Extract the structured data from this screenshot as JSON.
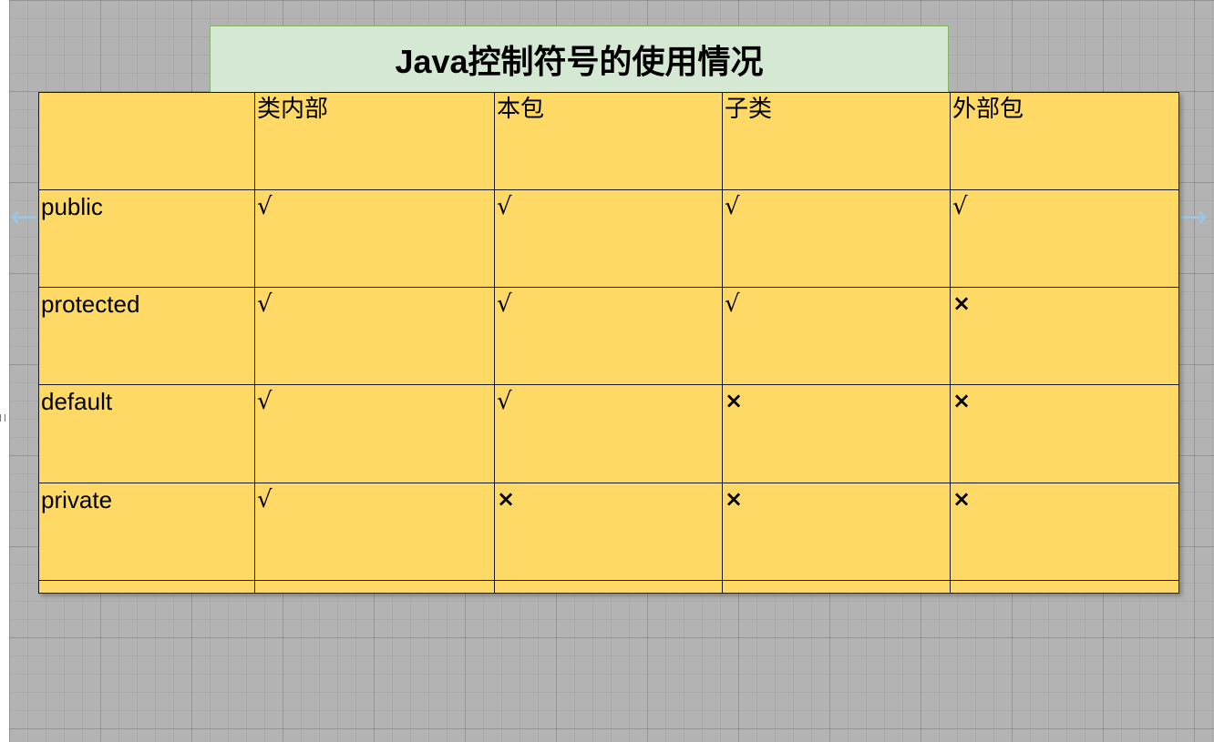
{
  "title": "Java控制符号的使用情况",
  "table": {
    "headers": [
      "",
      "类内部",
      "本包",
      "子类",
      "外部包"
    ],
    "rows": [
      {
        "label": "public",
        "cells": [
          "√",
          "√",
          "√",
          "√"
        ]
      },
      {
        "label": "protected",
        "cells": [
          "√",
          "√",
          "√",
          "×"
        ]
      },
      {
        "label": "default",
        "cells": [
          "√",
          "√",
          "×",
          "×"
        ]
      },
      {
        "label": "private",
        "cells": [
          "√",
          "×",
          "×",
          "×"
        ]
      },
      {
        "label": "",
        "cells": [
          "",
          "",
          "",
          ""
        ]
      }
    ]
  },
  "colors": {
    "canvas": "#b3b3b3",
    "title_fill": "#d5e8d4",
    "title_stroke": "#82b366",
    "table_fill": "#ffd966",
    "connector_arrow": "#7eb3d6"
  }
}
